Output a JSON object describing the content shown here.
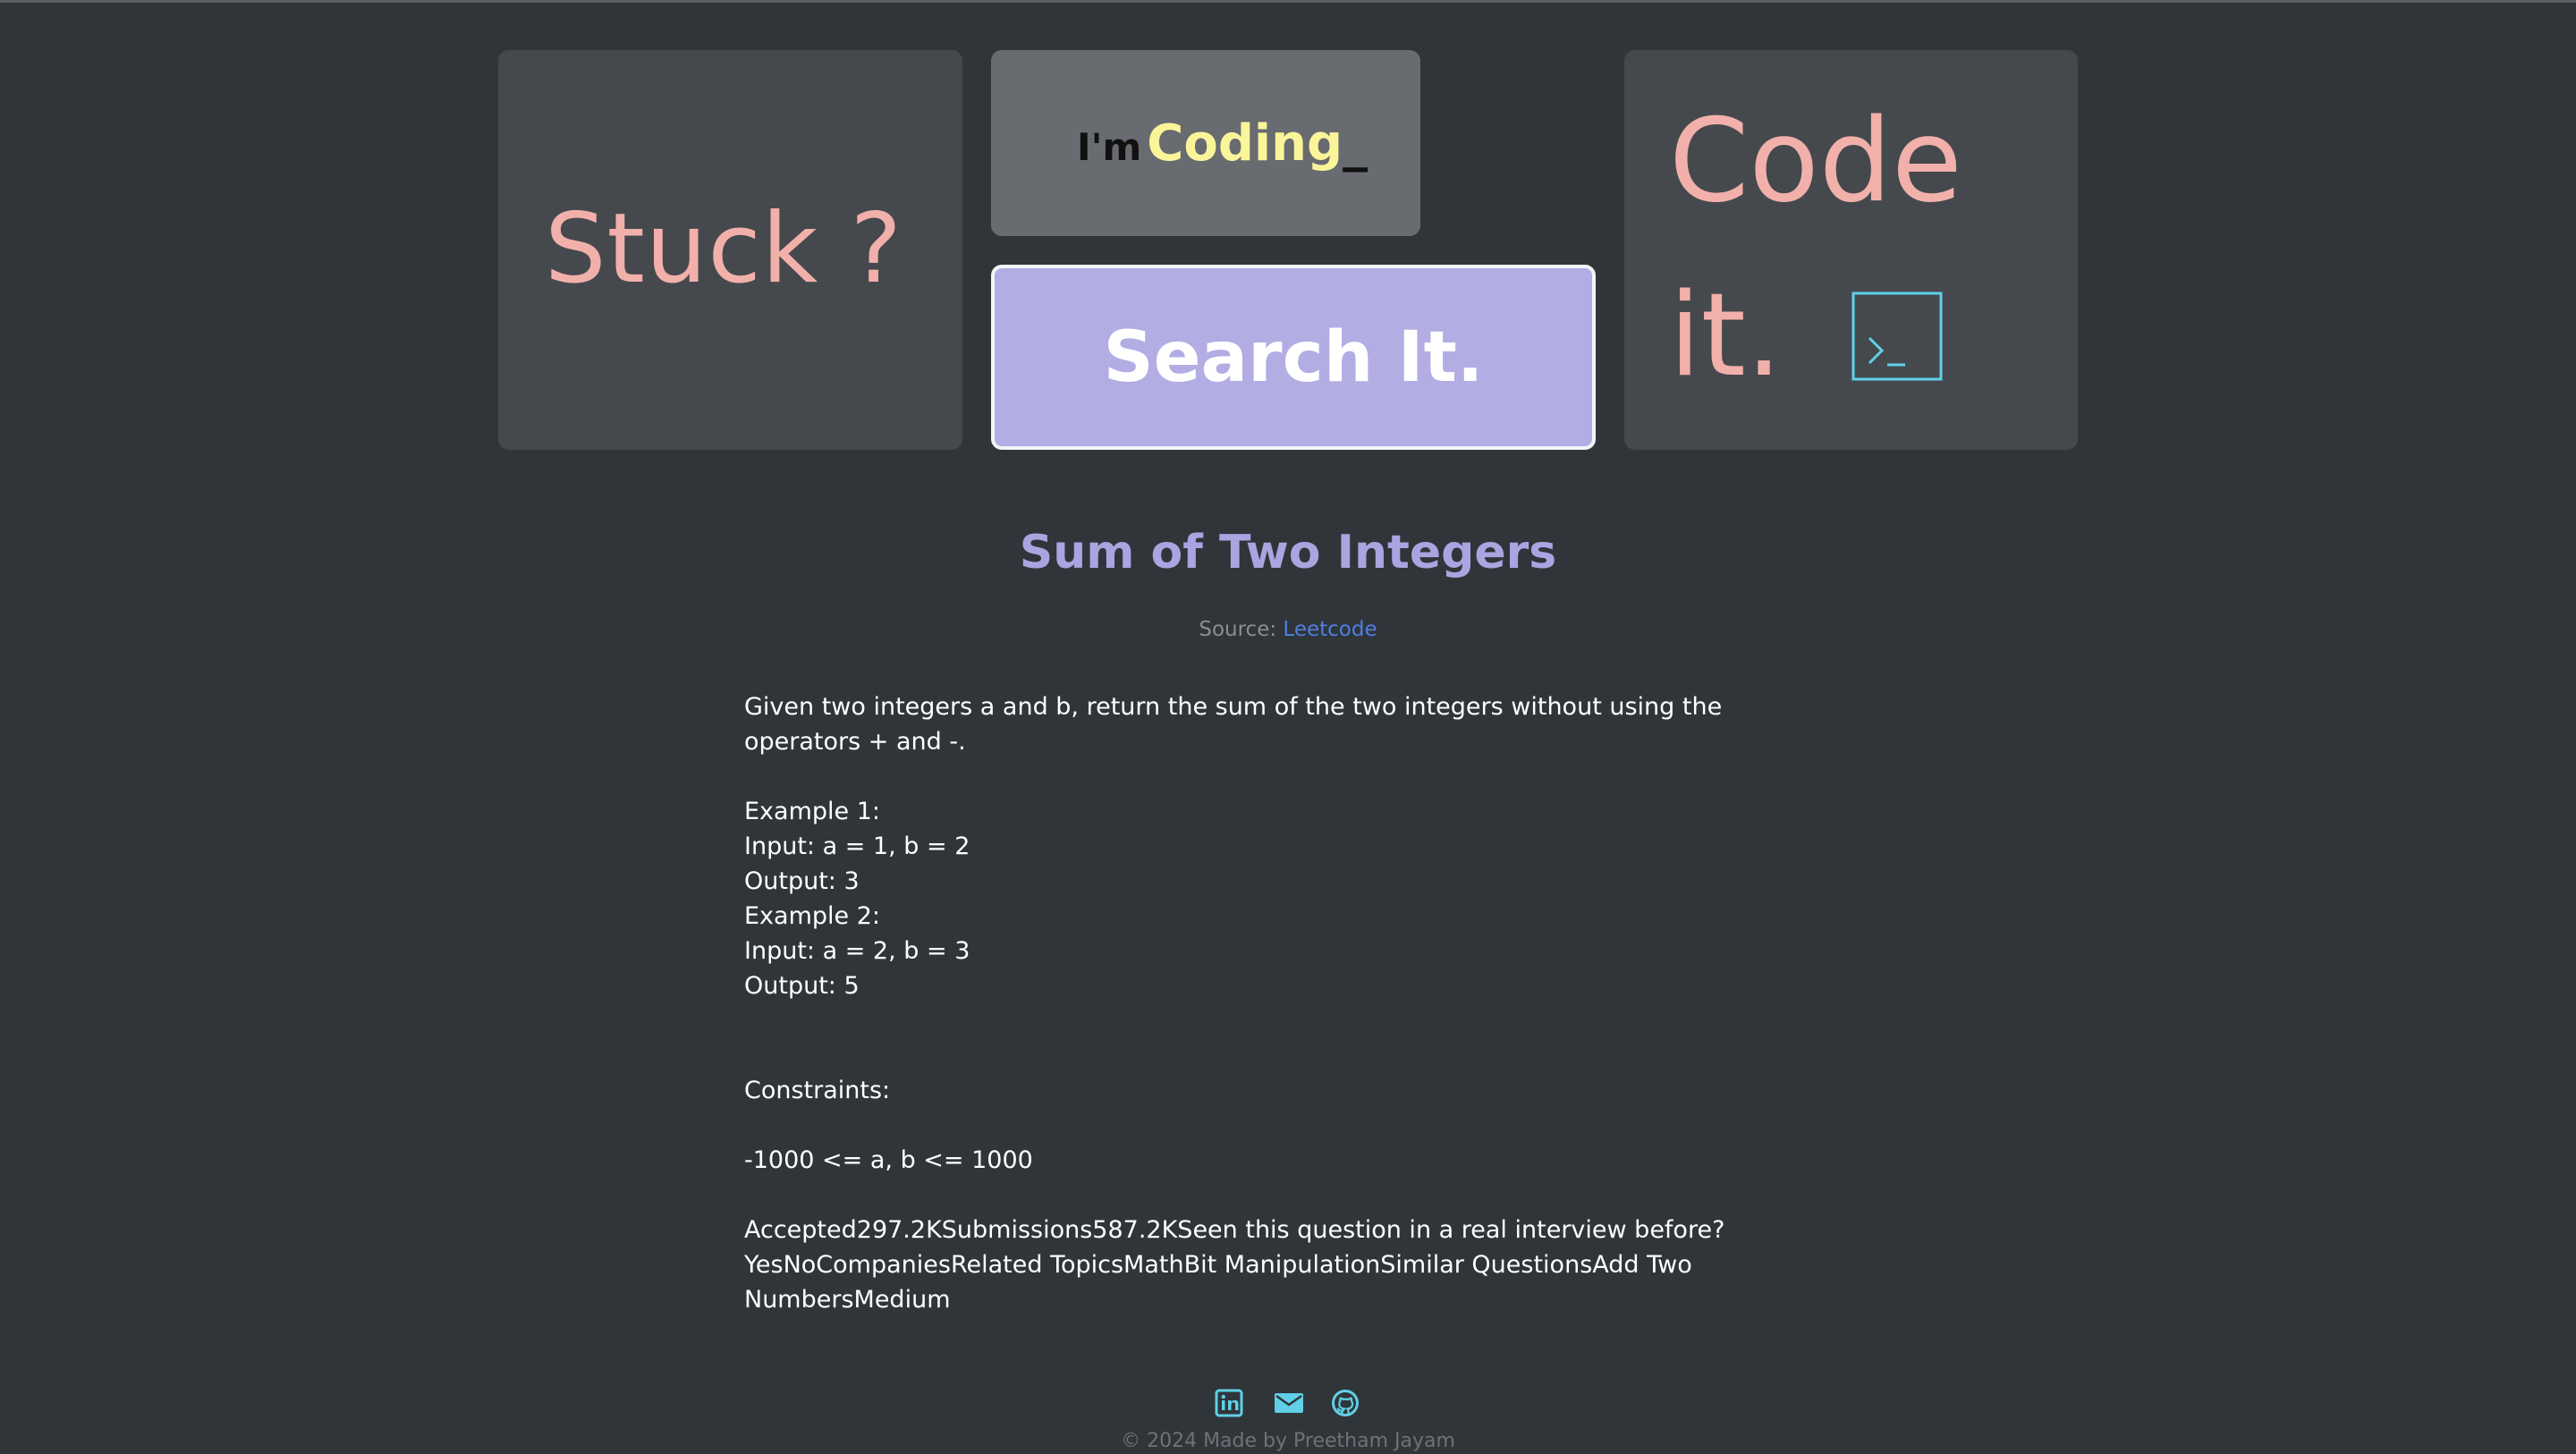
{
  "hero": {
    "stuck_text": "Stuck ?",
    "coding_prefix": "I'm",
    "coding_word": "Coding",
    "coding_cursor": "_",
    "search_label": "Search It.",
    "code_line1": "Code",
    "code_line2": "it."
  },
  "problem": {
    "title": "Sum of Two Integers",
    "source_label": "Source:",
    "source_link": "Leetcode",
    "description": [
      "Given two integers a and b, return the sum of the two integers without using the operators + and -."
    ],
    "examples": [
      "Example 1:",
      "Input: a = 1, b = 2",
      "Output: 3",
      "Example 2:",
      "Input: a = 2, b = 3",
      "Output: 5"
    ],
    "constraints_label": "Constraints:",
    "constraint": "-1000 <= a, b <= 1000",
    "stats": "Accepted297.2KSubmissions587.2KSeen this question in a real interview before? YesNoCompaniesRelated TopicsMathBit ManipulationSimilar QuestionsAdd Two NumbersMedium"
  },
  "footer": {
    "icons": [
      "linkedin-icon",
      "mail-icon",
      "github-icon"
    ],
    "copyright": "© 2024 Made by Preetham Jayam"
  },
  "colors": {
    "background": "#30353a",
    "accent_pink": "#f2b0ab",
    "accent_yellow": "#fbf59a",
    "accent_purple": "#b2ade3",
    "icon_cyan": "#5fd0e6",
    "link_blue": "#4f7fe0"
  }
}
